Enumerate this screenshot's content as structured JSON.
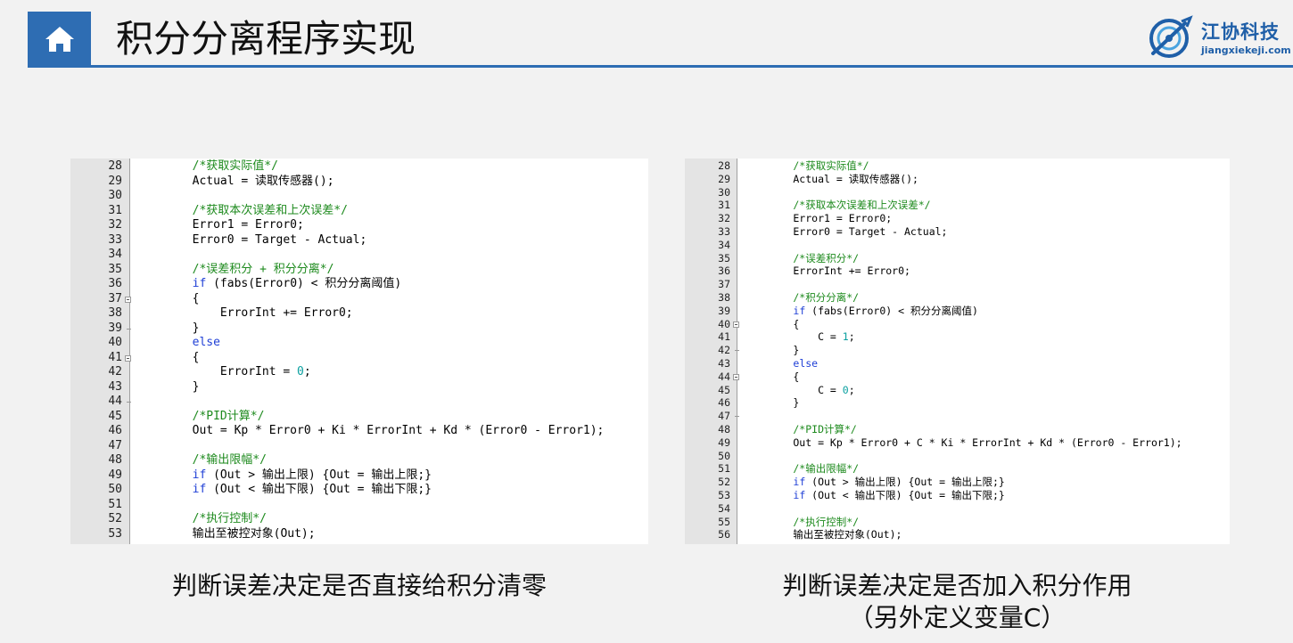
{
  "header": {
    "title": "积分分离程序实现",
    "home_icon": "home-icon",
    "accent": "#2e6db3"
  },
  "logo": {
    "name": "江协科技",
    "url": "jiangxiekeji.com"
  },
  "left_panel": {
    "lines": [
      {
        "n": "28",
        "segs": [
          {
            "t": "        /*获取实际值*/",
            "c": "cm"
          }
        ]
      },
      {
        "n": "29",
        "segs": [
          {
            "t": "        Actual = 读取传感器();",
            "c": ""
          }
        ]
      },
      {
        "n": "30",
        "segs": []
      },
      {
        "n": "31",
        "segs": [
          {
            "t": "        /*获取本次误差和上次误差*/",
            "c": "cm"
          }
        ]
      },
      {
        "n": "32",
        "segs": [
          {
            "t": "        Error1 = Error0;",
            "c": ""
          }
        ]
      },
      {
        "n": "33",
        "segs": [
          {
            "t": "        Error0 = Target - Actual;",
            "c": ""
          }
        ]
      },
      {
        "n": "34",
        "segs": []
      },
      {
        "n": "35",
        "segs": [
          {
            "t": "        /*误差积分 + 积分分离*/",
            "c": "cm"
          }
        ]
      },
      {
        "n": "36",
        "segs": [
          {
            "t": "        ",
            "c": ""
          },
          {
            "t": "if",
            "c": "kw"
          },
          {
            "t": " (fabs(Error0) < 积分分离阈值)",
            "c": ""
          }
        ]
      },
      {
        "n": "37",
        "fold": "open",
        "segs": [
          {
            "t": "        {",
            "c": ""
          }
        ]
      },
      {
        "n": "38",
        "segs": [
          {
            "t": "            ErrorInt += Error0;",
            "c": ""
          }
        ]
      },
      {
        "n": "39",
        "fold": "end",
        "segs": [
          {
            "t": "        }",
            "c": ""
          }
        ]
      },
      {
        "n": "40",
        "segs": [
          {
            "t": "        ",
            "c": ""
          },
          {
            "t": "else",
            "c": "kw"
          }
        ]
      },
      {
        "n": "41",
        "fold": "open",
        "segs": [
          {
            "t": "        {",
            "c": ""
          }
        ]
      },
      {
        "n": "42",
        "segs": [
          {
            "t": "            ErrorInt = ",
            "c": ""
          },
          {
            "t": "0",
            "c": "num"
          },
          {
            "t": ";",
            "c": ""
          }
        ]
      },
      {
        "n": "43",
        "segs": [
          {
            "t": "        }",
            "c": ""
          }
        ]
      },
      {
        "n": "44",
        "fold": "end",
        "segs": []
      },
      {
        "n": "45",
        "segs": [
          {
            "t": "        /*PID计算*/",
            "c": "cm"
          }
        ]
      },
      {
        "n": "46",
        "segs": [
          {
            "t": "        Out = Kp * Error0 + Ki * ErrorInt + Kd * (Error0 - Error1);",
            "c": ""
          }
        ]
      },
      {
        "n": "47",
        "segs": []
      },
      {
        "n": "48",
        "segs": [
          {
            "t": "        /*输出限幅*/",
            "c": "cm"
          }
        ]
      },
      {
        "n": "49",
        "segs": [
          {
            "t": "        ",
            "c": ""
          },
          {
            "t": "if",
            "c": "kw"
          },
          {
            "t": " (Out > 输出上限) {Out = 输出上限;}",
            "c": ""
          }
        ]
      },
      {
        "n": "50",
        "segs": [
          {
            "t": "        ",
            "c": ""
          },
          {
            "t": "if",
            "c": "kw"
          },
          {
            "t": " (Out < 输出下限) {Out = 输出下限;}",
            "c": ""
          }
        ]
      },
      {
        "n": "51",
        "segs": []
      },
      {
        "n": "52",
        "segs": [
          {
            "t": "        /*执行控制*/",
            "c": "cm"
          }
        ]
      },
      {
        "n": "53",
        "segs": [
          {
            "t": "        输出至被控对象(Out);",
            "c": ""
          }
        ]
      }
    ],
    "caption": "判断误差决定是否直接给积分清零"
  },
  "right_panel": {
    "lines": [
      {
        "n": "28",
        "segs": [
          {
            "t": "        /*获取实际值*/",
            "c": "cm"
          }
        ]
      },
      {
        "n": "29",
        "segs": [
          {
            "t": "        Actual = 读取传感器();",
            "c": ""
          }
        ]
      },
      {
        "n": "30",
        "segs": []
      },
      {
        "n": "31",
        "segs": [
          {
            "t": "        /*获取本次误差和上次误差*/",
            "c": "cm"
          }
        ]
      },
      {
        "n": "32",
        "segs": [
          {
            "t": "        Error1 = Error0;",
            "c": ""
          }
        ]
      },
      {
        "n": "33",
        "segs": [
          {
            "t": "        Error0 = Target - Actual;",
            "c": ""
          }
        ]
      },
      {
        "n": "34",
        "segs": []
      },
      {
        "n": "35",
        "segs": [
          {
            "t": "        /*误差积分*/",
            "c": "cm"
          }
        ]
      },
      {
        "n": "36",
        "segs": [
          {
            "t": "        ErrorInt += Error0;",
            "c": ""
          }
        ]
      },
      {
        "n": "37",
        "segs": []
      },
      {
        "n": "38",
        "segs": [
          {
            "t": "        /*积分分离*/",
            "c": "cm"
          }
        ]
      },
      {
        "n": "39",
        "segs": [
          {
            "t": "        ",
            "c": ""
          },
          {
            "t": "if",
            "c": "kw"
          },
          {
            "t": " (fabs(Error0) < 积分分离阈值)",
            "c": ""
          }
        ]
      },
      {
        "n": "40",
        "fold": "open",
        "segs": [
          {
            "t": "        {",
            "c": ""
          }
        ]
      },
      {
        "n": "41",
        "segs": [
          {
            "t": "            C = ",
            "c": ""
          },
          {
            "t": "1",
            "c": "num"
          },
          {
            "t": ";",
            "c": ""
          }
        ]
      },
      {
        "n": "42",
        "fold": "end",
        "segs": [
          {
            "t": "        }",
            "c": ""
          }
        ]
      },
      {
        "n": "43",
        "segs": [
          {
            "t": "        ",
            "c": ""
          },
          {
            "t": "else",
            "c": "kw"
          }
        ]
      },
      {
        "n": "44",
        "fold": "open",
        "segs": [
          {
            "t": "        {",
            "c": ""
          }
        ]
      },
      {
        "n": "45",
        "segs": [
          {
            "t": "            C = ",
            "c": ""
          },
          {
            "t": "0",
            "c": "num"
          },
          {
            "t": ";",
            "c": ""
          }
        ]
      },
      {
        "n": "46",
        "segs": [
          {
            "t": "        }",
            "c": ""
          }
        ]
      },
      {
        "n": "47",
        "fold": "end",
        "segs": []
      },
      {
        "n": "48",
        "segs": [
          {
            "t": "        /*PID计算*/",
            "c": "cm"
          }
        ]
      },
      {
        "n": "49",
        "segs": [
          {
            "t": "        Out = Kp * Error0 + C * Ki * ErrorInt + Kd * (Error0 - Error1);",
            "c": ""
          }
        ]
      },
      {
        "n": "50",
        "segs": []
      },
      {
        "n": "51",
        "segs": [
          {
            "t": "        /*输出限幅*/",
            "c": "cm"
          }
        ]
      },
      {
        "n": "52",
        "segs": [
          {
            "t": "        ",
            "c": ""
          },
          {
            "t": "if",
            "c": "kw"
          },
          {
            "t": " (Out > 输出上限) {Out = 输出上限;}",
            "c": ""
          }
        ]
      },
      {
        "n": "53",
        "segs": [
          {
            "t": "        ",
            "c": ""
          },
          {
            "t": "if",
            "c": "kw"
          },
          {
            "t": " (Out < 输出下限) {Out = 输出下限;}",
            "c": ""
          }
        ]
      },
      {
        "n": "54",
        "segs": []
      },
      {
        "n": "55",
        "segs": [
          {
            "t": "        /*执行控制*/",
            "c": "cm"
          }
        ]
      },
      {
        "n": "56",
        "segs": [
          {
            "t": "        输出至被控对象(Out);",
            "c": ""
          }
        ]
      }
    ],
    "caption_line1": "判断误差决定是否加入积分作用",
    "caption_line2": "（另外定义变量C）"
  }
}
